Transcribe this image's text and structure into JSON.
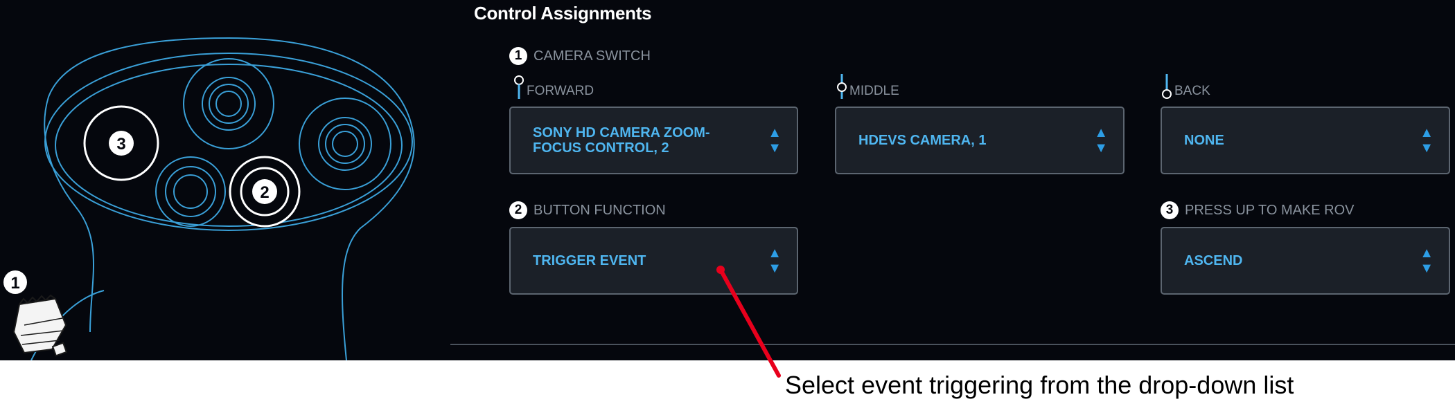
{
  "title": "Control Assignments",
  "controller": {
    "label_1": "1",
    "label_2": "2",
    "label_3": "3"
  },
  "camera_switch": {
    "number": "1",
    "label": "CAMERA SWITCH",
    "forward": {
      "label": "FORWARD",
      "value_line1": "SONY HD CAMERA ZOOM-",
      "value_line2": "FOCUS CONTROL, 2"
    },
    "middle": {
      "label": "MIDDLE",
      "value": "HDEVS CAMERA, 1"
    },
    "back": {
      "label": "BACK",
      "value": "NONE"
    }
  },
  "button_function": {
    "number": "2",
    "label": "BUTTON FUNCTION",
    "value": "TRIGGER EVENT"
  },
  "press_up": {
    "number": "3",
    "label": "PRESS UP TO MAKE ROV",
    "value": "ASCEND"
  },
  "arrow_up": "▲",
  "arrow_down": "▼",
  "callout": "Select event triggering from the drop-down list",
  "colors": {
    "background": "#05070d",
    "accent": "#4fb6f0",
    "callout_line": "#e8001c",
    "controller_outline": "#3aa0d8"
  },
  "icons": [
    "controller-outline",
    "camera-switch-knob-icon",
    "switch-forward-icon",
    "switch-middle-icon",
    "switch-back-icon",
    "up-down-arrow-icon"
  ]
}
